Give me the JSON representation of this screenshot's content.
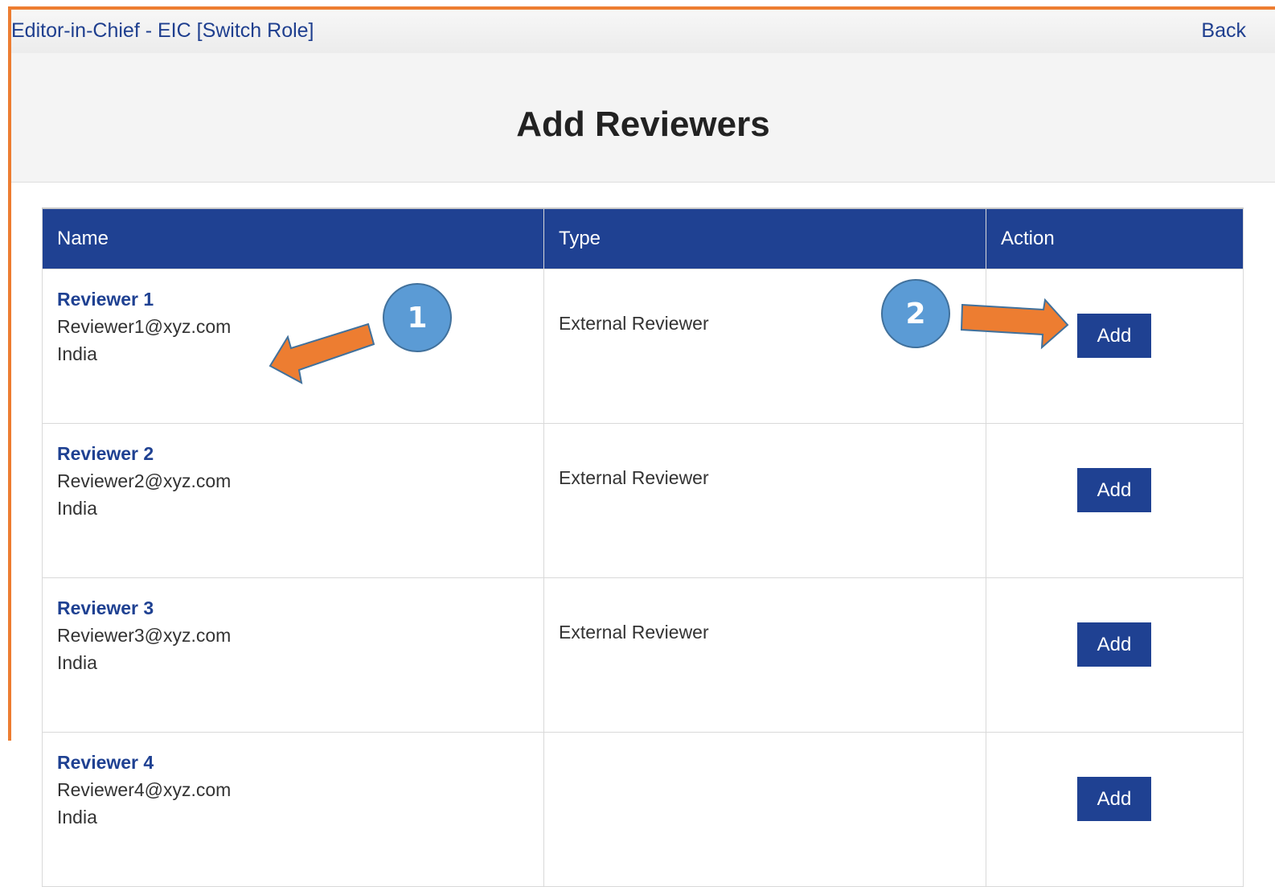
{
  "topbar": {
    "role_text": "Editor-in-Chief",
    "role_sep": " - ",
    "role_code": "EIC [Switch Role]",
    "back_label": "Back"
  },
  "page": {
    "title": "Add Reviewers"
  },
  "table": {
    "headers": [
      "Name",
      "Type",
      "Action"
    ],
    "rows": [
      {
        "name": "Reviewer 1",
        "email": "Reviewer1@xyz.com",
        "country": "India",
        "type": "External Reviewer",
        "action": "Add"
      },
      {
        "name": "Reviewer 2",
        "email": "Reviewer2@xyz.com",
        "country": "India",
        "type": "External Reviewer",
        "action": "Add"
      },
      {
        "name": "Reviewer 3",
        "email": "Reviewer3@xyz.com",
        "country": "India",
        "type": "External Reviewer",
        "action": "Add"
      },
      {
        "name": "Reviewer 4",
        "email": "Reviewer4@xyz.com",
        "country": "India",
        "type": "",
        "action": "Add"
      }
    ]
  },
  "callouts": [
    "1",
    "2"
  ],
  "colors": {
    "header_blue": "#1f4192",
    "accent_orange": "#ed7d31",
    "callout_blue": "#5b9bd5"
  }
}
